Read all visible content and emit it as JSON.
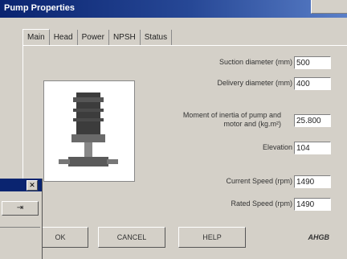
{
  "window": {
    "title": "Pump Properties"
  },
  "tabs": [
    "Main",
    "Head",
    "Power",
    "NPSH",
    "Status"
  ],
  "fields": {
    "suction": {
      "label": "Suction diameter (mm)",
      "value": "500"
    },
    "delivery": {
      "label": "Delivery diameter (mm)",
      "value": "400"
    },
    "moment": {
      "label1": "Moment of inertia of pump and",
      "label2": "motor and (kg.m²)",
      "value": "25.800"
    },
    "elevation": {
      "label": "Elevation",
      "value": "104"
    },
    "current": {
      "label": "Current Speed (rpm)",
      "value": "1490"
    },
    "rated": {
      "label": "Rated Speed (rpm)",
      "value": "1490"
    }
  },
  "buttons": {
    "ok": "OK",
    "cancel": "CANCEL",
    "help": "HELP"
  },
  "brand": "AHGB",
  "icons": {
    "close": "close-icon",
    "action": "arrow-right-icon"
  }
}
